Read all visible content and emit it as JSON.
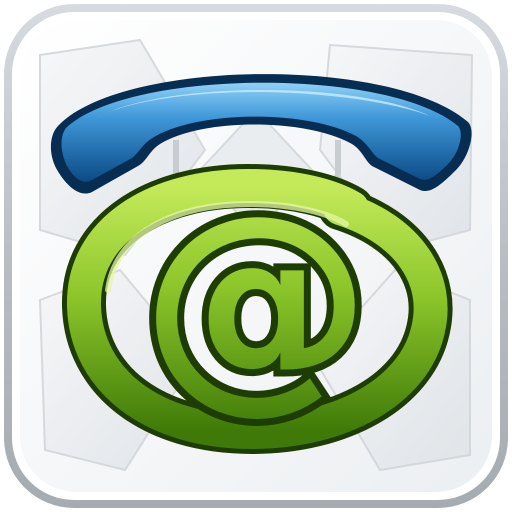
{
  "icon": {
    "name": "phone-email-app-icon",
    "glyphs": {
      "handset": "telephone-handset-icon",
      "at_sign": "at-sign-icon"
    },
    "symbol_text": "@",
    "colors": {
      "frame_outer": "#b8bdc2",
      "frame_inner": "#ffffff",
      "tile_light": "#f1f3f5",
      "tile_shade": "#d9dde1",
      "handset_blue_light": "#5fb0e6",
      "handset_blue_dark": "#0a4f8c",
      "handset_outline": "#072d52",
      "at_green_light": "#a4d636",
      "at_green_dark": "#3f7a08",
      "at_outline": "#1e3d05"
    }
  }
}
